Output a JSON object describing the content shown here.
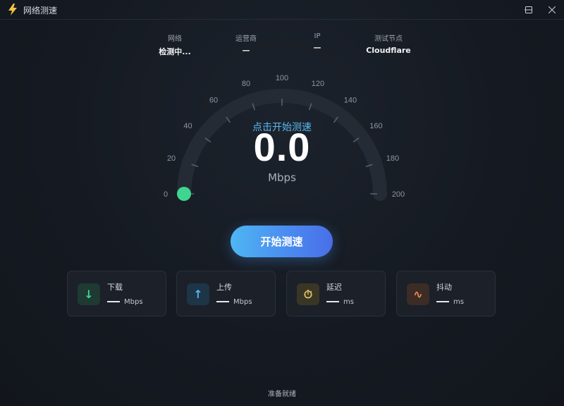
{
  "window": {
    "title": "网络测速",
    "app_icon": "lightning-icon"
  },
  "info": [
    {
      "label": "网络",
      "value": "检测中..."
    },
    {
      "label": "运营商",
      "value": "—"
    },
    {
      "label": "IP",
      "value": "—"
    },
    {
      "label": "测试节点",
      "value": "Cloudflare"
    }
  ],
  "gauge": {
    "ticks": [
      "0",
      "20",
      "40",
      "60",
      "80",
      "100",
      "120",
      "140",
      "160",
      "180",
      "200"
    ],
    "min": 0,
    "max": 200,
    "value": 0,
    "status": "点击开始测速",
    "speed": "0.0",
    "unit": "Mbps"
  },
  "start_button": {
    "label": "开始测速"
  },
  "cards": [
    {
      "title": "下载",
      "value": "—",
      "unit": "Mbps",
      "icon": "download-arrow-icon",
      "glyph": "↓",
      "color": "#3fd58f"
    },
    {
      "title": "上传",
      "value": "—",
      "unit": "Mbps",
      "icon": "upload-arrow-icon",
      "glyph": "↑",
      "color": "#4fb6f2"
    },
    {
      "title": "延迟",
      "value": "—",
      "unit": "ms",
      "icon": "stopwatch-icon",
      "glyph": "⏱",
      "color": "#e8c46a"
    },
    {
      "title": "抖动",
      "value": "—",
      "unit": "ms",
      "icon": "wave-icon",
      "glyph": "∿",
      "color": "#f08a4b"
    }
  ],
  "footer": {
    "status": "准备就绪"
  },
  "colors": {
    "accent": "#4fb6f2",
    "needle_dot": "#3fd58f",
    "background": "#14181f"
  }
}
